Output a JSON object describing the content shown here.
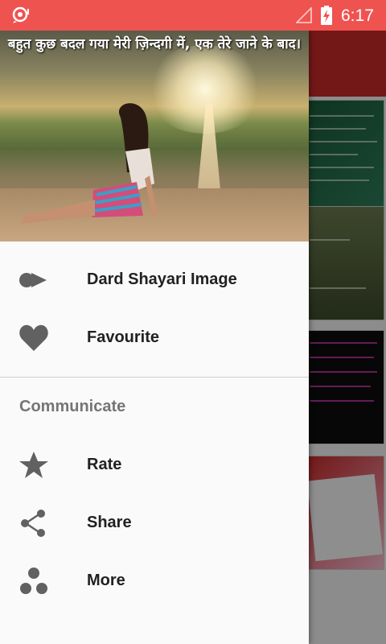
{
  "status_bar": {
    "time": "6:17"
  },
  "drawer": {
    "header_caption": "बहुत कुछ बदल गया मेरी ज़िन्दगी में, एक तेरे जाने के बाद।",
    "primary_items": [
      {
        "label": "Dard Shayari Image",
        "icon": "gallery-icon"
      },
      {
        "label": "Favourite",
        "icon": "heart-icon"
      }
    ],
    "section_title": "Communicate",
    "communicate_items": [
      {
        "label": "Rate",
        "icon": "star-icon"
      },
      {
        "label": "Share",
        "icon": "share-icon"
      },
      {
        "label": "More",
        "icon": "more-apps-icon"
      }
    ]
  },
  "colors": {
    "status_bar": "#ef5350",
    "icon_grey": "#616161",
    "drawer_bg": "#fafafa"
  }
}
